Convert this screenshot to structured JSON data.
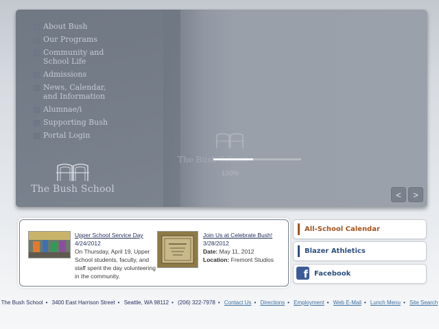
{
  "nav": [
    "About Bush",
    "Our Programs",
    "Community and School Life",
    "Admissions",
    "News, Calendar, and Information",
    "Alumnae/i",
    "Supporting Bush",
    "Portal Login"
  ],
  "logo": {
    "text": "The Bush School"
  },
  "loader": {
    "ghost_text": "The Bush School",
    "percent_text": "100%",
    "progress": 0.45
  },
  "slider": {
    "prev": "<",
    "next": ">"
  },
  "news": [
    {
      "title": "Upper School Service Day",
      "date": "4/24/2012",
      "body": "On Thursday, April 19, Upper School students, faculty, and staff spent the day volunteering in the community."
    },
    {
      "title": "Join Us at Celebrate Bush!",
      "date": "3/28/2012",
      "date_label": "Date:",
      "date_value": "May 11, 2012",
      "location_label": "Location:",
      "location_value": "Fremont Studios"
    }
  ],
  "side_buttons": [
    {
      "label": "All-School Calendar",
      "color": "#a2541c",
      "accent": "#a2541c"
    },
    {
      "label": "Blazer Athletics",
      "color": "#2d4f7f",
      "accent": "#2d4f7f"
    },
    {
      "label": "Facebook",
      "color": "#2a4d7a",
      "icon": "facebook-icon"
    }
  ],
  "footer": {
    "school": "The Bush School",
    "address": "3400 East Harrison Street",
    "city": "Seattle, WA 98112",
    "phone": "(206) 322-7978",
    "links": [
      "Contact Us",
      "Directions",
      "Employment",
      "Web E-Mail",
      "Lunch Menu",
      "Site Search"
    ]
  },
  "colors": {
    "hero_gray": "#858c98",
    "nav_text": "#c5cbd3",
    "link_blue": "#3a6f9f",
    "footer_text": "#25305e"
  }
}
